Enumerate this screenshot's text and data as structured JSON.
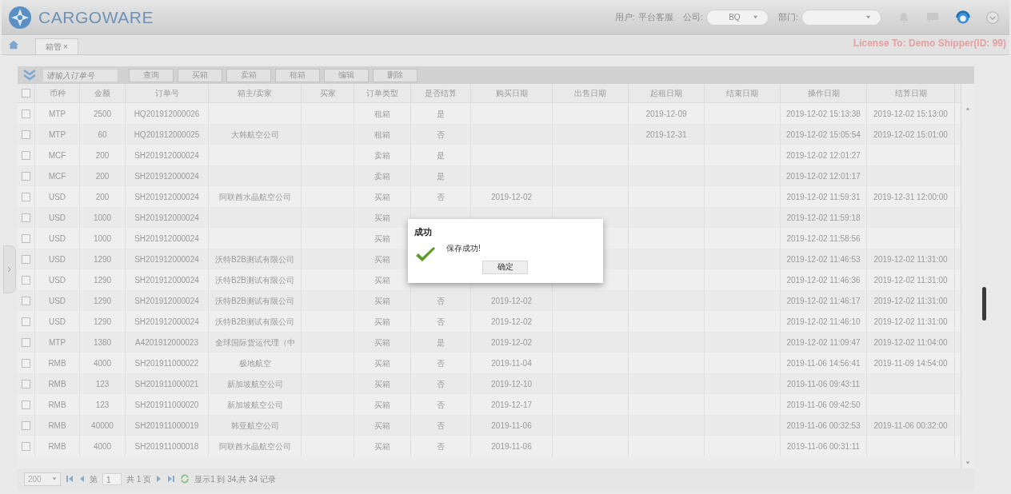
{
  "header": {
    "logo": "CARGOWARE",
    "user_label": "用户:",
    "user_name": "平台客服",
    "company_label": "公司:",
    "company_value": "BQ",
    "department_label": "部门:"
  },
  "tabs": [
    {
      "label": "箱管",
      "close": "×",
      "selected": true
    }
  ],
  "license": "License To: Demo Shipper(ID: 99)",
  "toolbar": {
    "search_placeholder": "请输入订单号",
    "buttons": [
      "查询",
      "买箱",
      "卖箱",
      "租箱",
      "编辑",
      "删除"
    ]
  },
  "table": {
    "all_checked": false,
    "columns": [
      "币种",
      "金额",
      "订单号",
      "箱主/卖家",
      "买家",
      "订单类型",
      "是否结算",
      "购买日期",
      "出售日期",
      "起租日期",
      "结束日期",
      "操作日期",
      "结算日期"
    ],
    "rows": [
      {
        "checked": false,
        "currency": "MTP",
        "amount": "2500",
        "order_no": "HQ201912000026",
        "order_type": "租箱",
        "settled": "是",
        "start_date": "2019-12-09",
        "operated": "2019-12-02 15:13:38",
        "settle_date": "2019-12-02 15:13:00"
      },
      {
        "checked": false,
        "currency": "MTP",
        "amount": "60",
        "order_no": "HQ201912000025",
        "owner": "大韩航空公司",
        "order_type": "租箱",
        "settled": "否",
        "start_date": "2019-12-31",
        "operated": "2019-12-02 15:05:54",
        "settle_date": "2019-12-02 15:01:00"
      },
      {
        "checked": false,
        "currency": "MCF",
        "amount": "200",
        "order_no": "SH201912000024",
        "order_type": "卖箱",
        "settled": "是",
        "operated": "2019-12-02 12:01:27"
      },
      {
        "checked": false,
        "currency": "MCF",
        "amount": "200",
        "order_no": "SH201912000024",
        "order_type": "卖箱",
        "settled": "是",
        "operated": "2019-12-02 12:01:17"
      },
      {
        "checked": false,
        "currency": "USD",
        "amount": "200",
        "order_no": "SH201912000024",
        "owner": "阿联酋水晶航空公司",
        "order_type": "买箱",
        "settled": "否",
        "buy_date": "2019-12-02",
        "operated": "2019-12-02 11:59:31",
        "settle_date": "2019-12-31 12:00:00"
      },
      {
        "checked": false,
        "currency": "USD",
        "amount": "1000",
        "order_no": "SH201912000024",
        "order_type": "买箱",
        "operated": "2019-12-02 11:59:18"
      },
      {
        "checked": false,
        "currency": "USD",
        "amount": "1000",
        "order_no": "SH201912000024",
        "order_type": "买箱",
        "operated": "2019-12-02 11:58:56"
      },
      {
        "checked": false,
        "currency": "USD",
        "amount": "1290",
        "order_no": "SH201912000024",
        "owner": "沃特B2B测试有限公司",
        "order_type": "买箱",
        "operated": "2019-12-02 11:46:53",
        "settle_date": "2019-12-02 11:31:00"
      },
      {
        "checked": false,
        "currency": "USD",
        "amount": "1290",
        "order_no": "SH201912000024",
        "owner": "沃特B2B测试有限公司",
        "order_type": "买箱",
        "operated": "2019-12-02 11:46:36",
        "settle_date": "2019-12-02 11:31:00"
      },
      {
        "checked": false,
        "currency": "USD",
        "amount": "1290",
        "order_no": "SH201912000024",
        "owner": "沃特B2B测试有限公司",
        "order_type": "买箱",
        "settled": "否",
        "buy_date": "2019-12-02",
        "operated": "2019-12-02 11:46:17",
        "settle_date": "2019-12-02 11:31:00"
      },
      {
        "checked": false,
        "currency": "USD",
        "amount": "1290",
        "order_no": "SH201912000024",
        "owner": "沃特B2B测试有限公司",
        "order_type": "买箱",
        "settled": "否",
        "buy_date": "2019-12-02",
        "operated": "2019-12-02 11:46:10",
        "settle_date": "2019-12-02 11:31:00"
      },
      {
        "checked": false,
        "currency": "MTP",
        "amount": "1380",
        "order_no": "A4201912000023",
        "owner": "全球国际货运代理（中",
        "order_type": "买箱",
        "settled": "是",
        "buy_date": "2019-12-02",
        "operated": "2019-12-02 11:09:47",
        "settle_date": "2019-12-02 11:04:00"
      },
      {
        "checked": false,
        "currency": "RMB",
        "amount": "4000",
        "order_no": "SH201911000022",
        "owner": "极地航空",
        "order_type": "买箱",
        "settled": "否",
        "buy_date": "2019-11-04",
        "operated": "2019-11-06 14:56:41",
        "settle_date": "2019-11-09 14:54:00"
      },
      {
        "checked": false,
        "currency": "RMB",
        "amount": "123",
        "order_no": "SH201911000021",
        "owner": "新加坡航空公司",
        "order_type": "买箱",
        "settled": "否",
        "buy_date": "2019-12-10",
        "operated": "2019-11-06 09:43:11"
      },
      {
        "checked": false,
        "currency": "RMB",
        "amount": "123",
        "order_no": "SH201911000020",
        "owner": "新加坡航空公司",
        "order_type": "买箱",
        "settled": "否",
        "buy_date": "2019-12-17",
        "operated": "2019-11-06 09:42:50"
      },
      {
        "checked": false,
        "currency": "RMB",
        "amount": "40000",
        "order_no": "SH201911000019",
        "owner": "韩亚航空公司",
        "order_type": "买箱",
        "settled": "否",
        "buy_date": "2019-11-06",
        "operated": "2019-11-06 00:32:53",
        "settle_date": "2019-11-06 00:32:00"
      },
      {
        "checked": false,
        "currency": "RMB",
        "amount": "4000",
        "order_no": "SH201911000018",
        "owner": "阿联酋水晶航空公司",
        "order_type": "买箱",
        "settled": "否",
        "buy_date": "2019-11-06",
        "operated": "2019-11-06 00:31:11"
      }
    ]
  },
  "pager": {
    "page_size": "200",
    "page_label": "第",
    "page_value": "1",
    "total_pages": "共 1 页",
    "summary": "显示1 到 34,共 34 记录"
  },
  "dialog": {
    "title": "成功",
    "message": "保存成功!",
    "ok": "确定"
  }
}
